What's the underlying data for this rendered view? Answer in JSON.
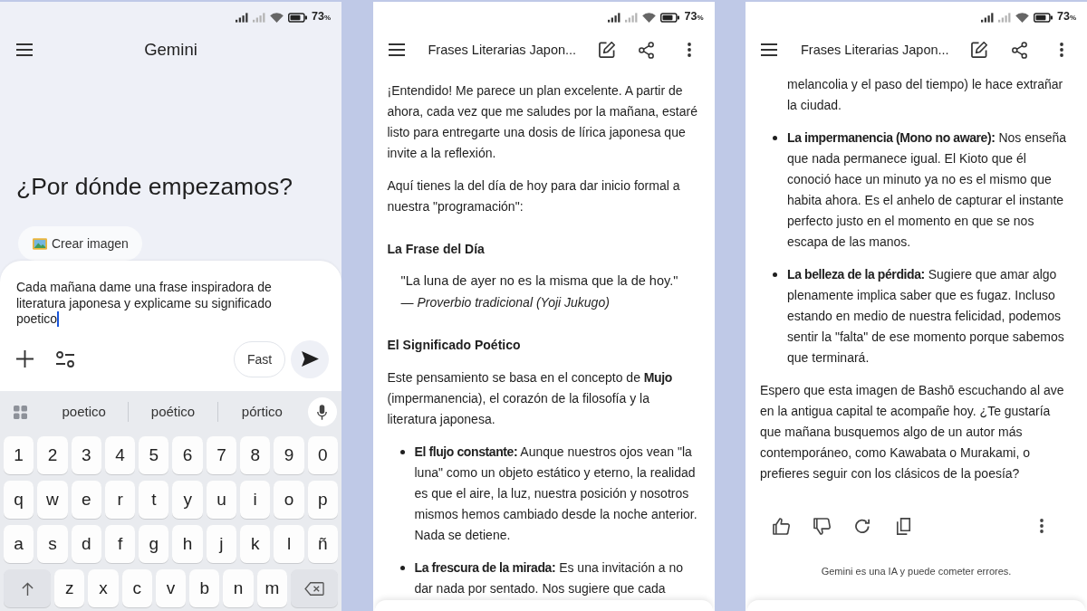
{
  "panels": [
    {
      "kind": "home",
      "status_bar": {
        "battery": "73",
        "battery_unit": "%"
      },
      "header": {
        "title": "Gemini"
      },
      "greeting": "¿Por dónde empezamos?",
      "chips": [
        {
          "label": "Crear imagen"
        }
      ],
      "composer": {
        "value": "Cada mañana dame una frase inspiradora de literatura japonesa y explicame su significado poetico",
        "mode_button": "Fast"
      },
      "keyboard": {
        "suggestions": [
          "poetico",
          "poético",
          "pórtico"
        ],
        "rows": [
          [
            "1",
            "2",
            "3",
            "4",
            "5",
            "6",
            "7",
            "8",
            "9",
            "0"
          ],
          [
            "q",
            "w",
            "e",
            "r",
            "t",
            "y",
            "u",
            "i",
            "o",
            "p"
          ],
          [
            "a",
            "s",
            "d",
            "f",
            "g",
            "h",
            "j",
            "k",
            "l",
            "ñ"
          ]
        ],
        "bottom_row": [
          "z",
          "x",
          "c",
          "v",
          "b",
          "n",
          "m"
        ]
      }
    },
    {
      "kind": "chat",
      "status_bar": {
        "battery": "73",
        "battery_unit": "%"
      },
      "header": {
        "title": "Frases Literarias Japon..."
      },
      "blocks": [
        {
          "kind": "paragraph",
          "text": "¡Entendido! Me parece un plan excelente. A partir de ahora, cada vez que me saludes por la mañana, estaré listo para entregarte una dosis de lírica japonesa que invite a la reflexión."
        },
        {
          "kind": "paragraph",
          "text": "Aquí tienes la del día de hoy para dar inicio formal a nuestra \"programación\":"
        },
        {
          "kind": "heading",
          "text": "La Frase del Día"
        },
        {
          "kind": "quote",
          "text": "\"La luna de ayer no es la misma que la de hoy.\"",
          "attribution": "— Proverbio tradicional (Yoji Jukugo)"
        },
        {
          "kind": "heading",
          "text": "El Significado Poético"
        },
        {
          "kind": "paragraph",
          "text": "Este pensamiento se basa en el concepto de **Mujo** (impermanencia), el corazón de la filosofía y la literatura japonesa."
        },
        {
          "kind": "bullet",
          "text": "**El flujo constante:** Aunque nuestros ojos vean \"la luna\" como un objeto estático y eterno, la realidad es que el aire, la luz, nuestra posición y nosotros mismos hemos cambiado desde la noche anterior. Nada se detiene."
        },
        {
          "kind": "bullet",
          "text": "**La frescura de la mirada:** Es una invitación a no dar nada por sentado. Nos sugiere que cada"
        }
      ]
    },
    {
      "kind": "chat",
      "status_bar": {
        "battery": "73",
        "battery_unit": "%"
      },
      "header": {
        "title": "Frases Literarias Japon..."
      },
      "blocks": [
        {
          "kind": "continuation",
          "text": "melancolia y el paso del tiempo) le hace extrañar la ciudad."
        },
        {
          "kind": "bullet",
          "text": "**La impermanencia (Mono no aware):** Nos enseña que nada permanece igual. El Kioto que él conoció hace un minuto ya no es el mismo que habita ahora. Es el anhelo de capturar el instante perfecto justo en el momento en que se nos escapa de las manos."
        },
        {
          "kind": "bullet",
          "text": "**La belleza de la pérdida:** Sugiere que amar algo plenamente implica saber que es fugaz. Incluso estando en medio de nuestra felicidad, podemos sentir la \"falta\" de ese momento porque sabemos que terminará."
        },
        {
          "kind": "paragraph",
          "text": "Espero que esta imagen de Bashō escuchando al ave en la antigua capital te acompañe hoy. ¿Te gustaría que mañana busquemos algo de un autor más contemporáneo, como Kawabata o Murakami, o prefieres seguir con los clásicos de la poesía?"
        }
      ],
      "response_actions": true,
      "disclaimer": "Gemini es una IA y puede cometer errores."
    }
  ]
}
